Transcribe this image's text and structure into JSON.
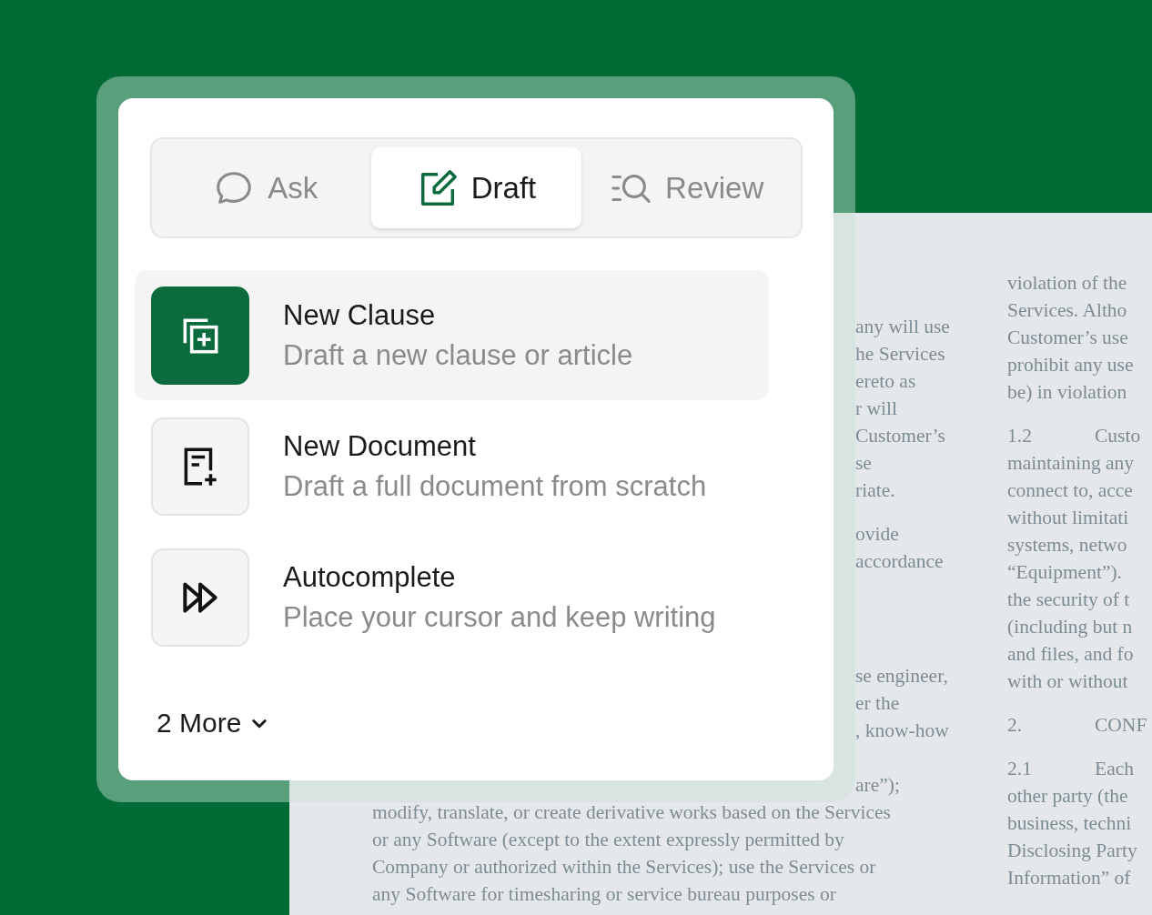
{
  "tabs": [
    {
      "label": "Ask",
      "kind": "chat",
      "selected": false
    },
    {
      "label": "Draft",
      "kind": "edit",
      "selected": true
    },
    {
      "label": "Review",
      "kind": "review",
      "selected": false
    }
  ],
  "actions": [
    {
      "title": "New Clause",
      "description": "Draft a new clause or article",
      "kind": "clause",
      "selected": true
    },
    {
      "title": "New Document",
      "description": "Draft a full document from scratch",
      "kind": "document",
      "selected": false
    },
    {
      "title": "Autocomplete",
      "description": "Place your cursor and keep writing",
      "kind": "forward",
      "selected": false
    }
  ],
  "more": {
    "label": "2 More"
  },
  "document": {
    "left_column": [
      {
        "lines": [
          {
            "kind": "fragment",
            "text": "any will use"
          },
          {
            "kind": "fragment",
            "text": "he Services"
          },
          {
            "kind": "fragment",
            "text": "ereto as"
          },
          {
            "kind": "fragment",
            "text": "r will"
          },
          {
            "kind": "fragment",
            "text": "Customer’s"
          },
          {
            "kind": "fragment",
            "text": "se"
          },
          {
            "kind": "fragment",
            "text": "riate."
          }
        ]
      },
      {
        "lines": [
          {
            "kind": "fragment",
            "text": "ovide"
          },
          {
            "kind": "fragment",
            "text": "accordance"
          }
        ]
      },
      {
        "lines": [
          {
            "kind": "fragment",
            "text": "se engineer,"
          },
          {
            "kind": "fragment",
            "text": "er the"
          },
          {
            "kind": "fragment",
            "text": ", know-how"
          }
        ]
      },
      {
        "lines": [
          {
            "kind": "fragment",
            "text": "are”);"
          },
          {
            "kind": "full",
            "text": "modify, translate, or create derivative works based on the Services"
          },
          {
            "kind": "full",
            "text": "or any Software (except to the extent expressly permitted by"
          },
          {
            "kind": "full",
            "text": "Company or authorized within the Services); use the Services or"
          },
          {
            "kind": "full",
            "text": "any Software for timesharing or service bureau purposes or"
          }
        ]
      }
    ],
    "right_column": [
      {
        "lines": [
          {
            "text": "violation of the"
          },
          {
            "text": "Services. Altho"
          },
          {
            "text": "Customer’s use"
          },
          {
            "text": "prohibit any use"
          },
          {
            "text": "be) in violation"
          }
        ]
      },
      {
        "number": "1.2",
        "lines": [
          {
            "text": "Custo"
          },
          {
            "text": "maintaining any"
          },
          {
            "text": "connect to, acce"
          },
          {
            "text": "without limitati"
          },
          {
            "text": "systems, netwo"
          },
          {
            "text": "“Equipment”)."
          },
          {
            "text": "the security of t"
          },
          {
            "text": "(including but n"
          },
          {
            "text": "and files, and fo"
          },
          {
            "text": "with or without"
          }
        ]
      },
      {
        "number": "2.",
        "lines": [
          {
            "text": "CONF"
          }
        ]
      },
      {
        "number": "2.1",
        "lines": [
          {
            "text": "Each"
          },
          {
            "text": "other party (the"
          },
          {
            "text": "business, techni"
          },
          {
            "text": "Disclosing Party"
          },
          {
            "text": "Information” of"
          }
        ]
      }
    ]
  }
}
